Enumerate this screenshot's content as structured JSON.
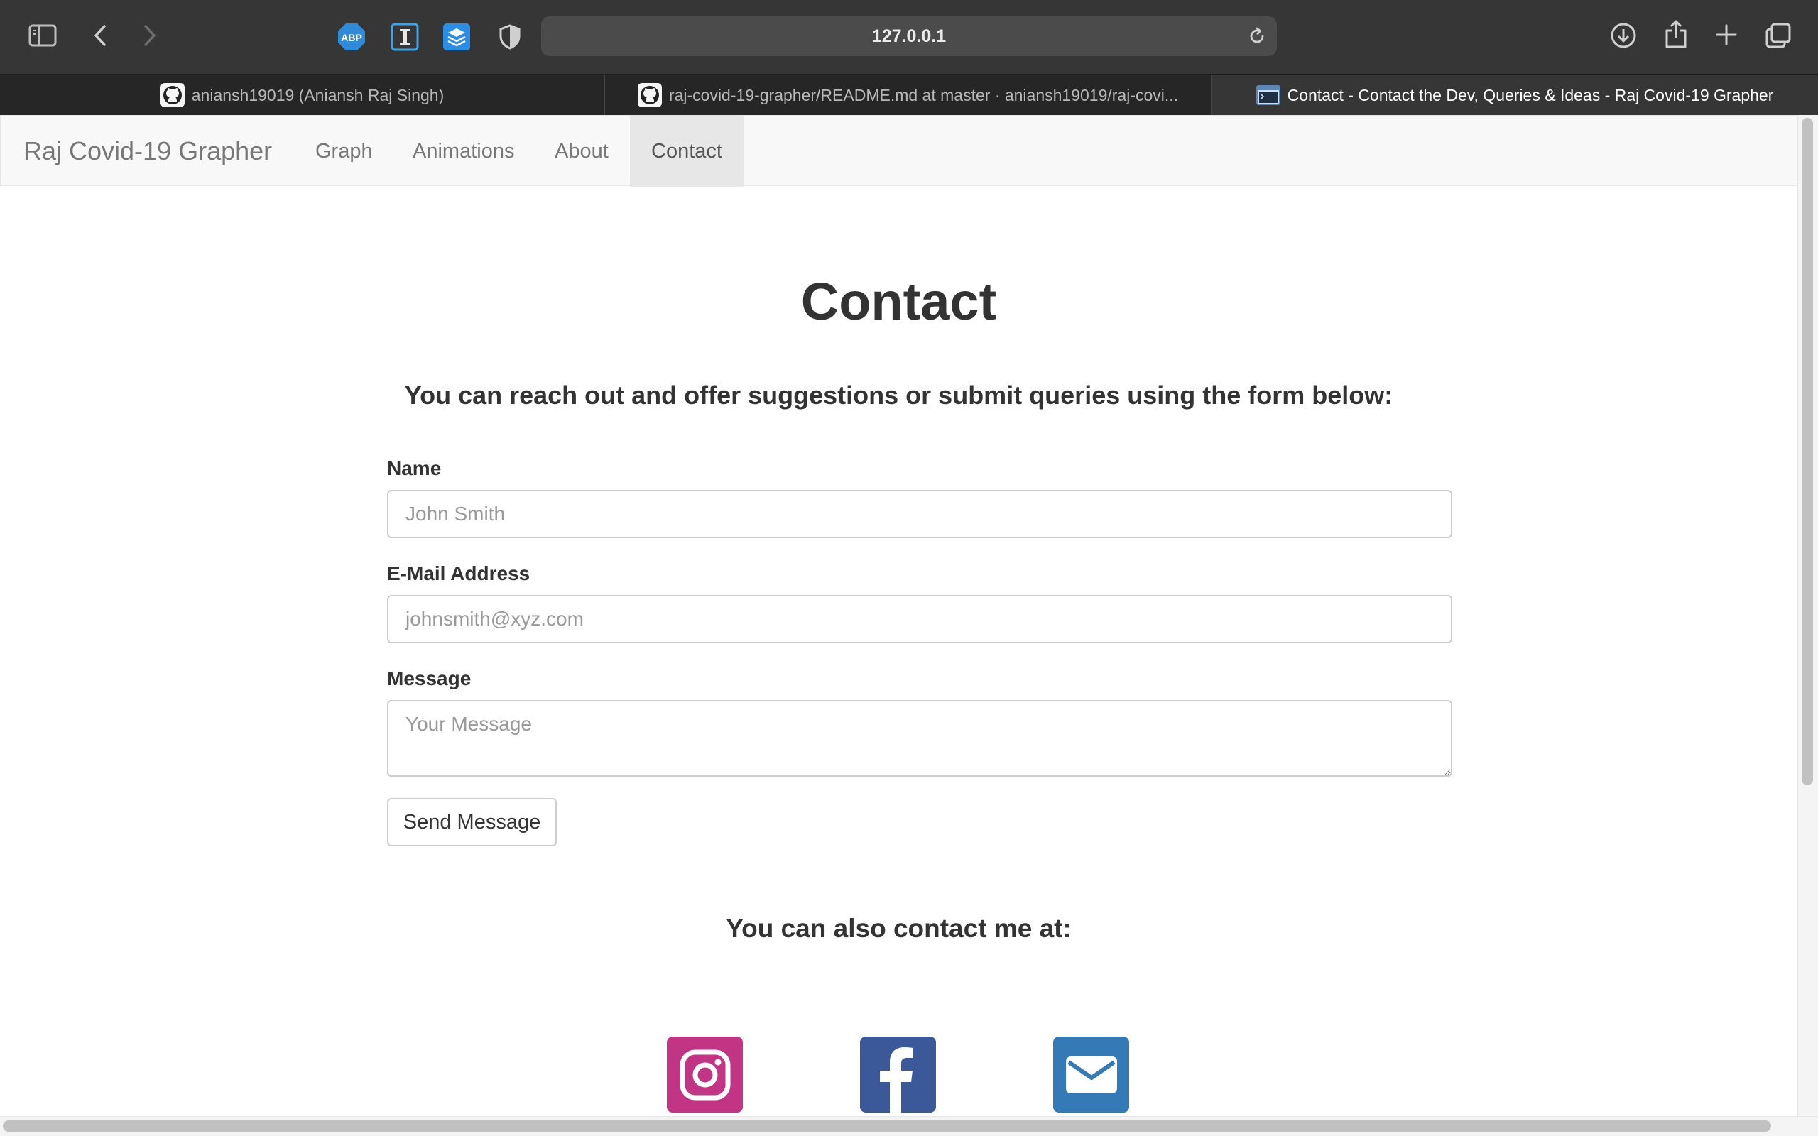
{
  "browser": {
    "url": "127.0.0.1",
    "tabs": [
      {
        "title": "aniansh19019 (Aniansh Raj Singh)",
        "icon": "github-icon",
        "active": false
      },
      {
        "title": "raj-covid-19-grapher/README.md at master · aniansh19019/raj-covi...",
        "icon": "github-icon",
        "active": false
      },
      {
        "title": "Contact - Contact the Dev, Queries & Ideas - Raj Covid-19 Grapher",
        "icon": "terminal-icon",
        "active": true
      }
    ],
    "extensions": [
      "adblock-plus-icon",
      "instapaper-icon",
      "buffer-icon",
      "privacy-shield-icon"
    ]
  },
  "navbar": {
    "brand": "Raj Covid-19 Grapher",
    "links": [
      "Graph",
      "Animations",
      "About",
      "Contact"
    ],
    "active": "Contact"
  },
  "main": {
    "title": "Contact",
    "lead": "You can reach out and offer suggestions or submit queries using the form below:",
    "form": {
      "name_label": "Name",
      "name_placeholder": "John Smith",
      "email_label": "E-Mail Address",
      "email_placeholder": "johnsmith@xyz.com",
      "message_label": "Message",
      "message_placeholder": "Your Message",
      "submit_label": "Send Message"
    },
    "also": "You can also contact me at:",
    "social": [
      {
        "icon": "instagram-icon",
        "color": "#c13584"
      },
      {
        "icon": "facebook-icon",
        "color": "#3b5998"
      },
      {
        "icon": "email-icon",
        "color": "#337ab7"
      }
    ]
  }
}
